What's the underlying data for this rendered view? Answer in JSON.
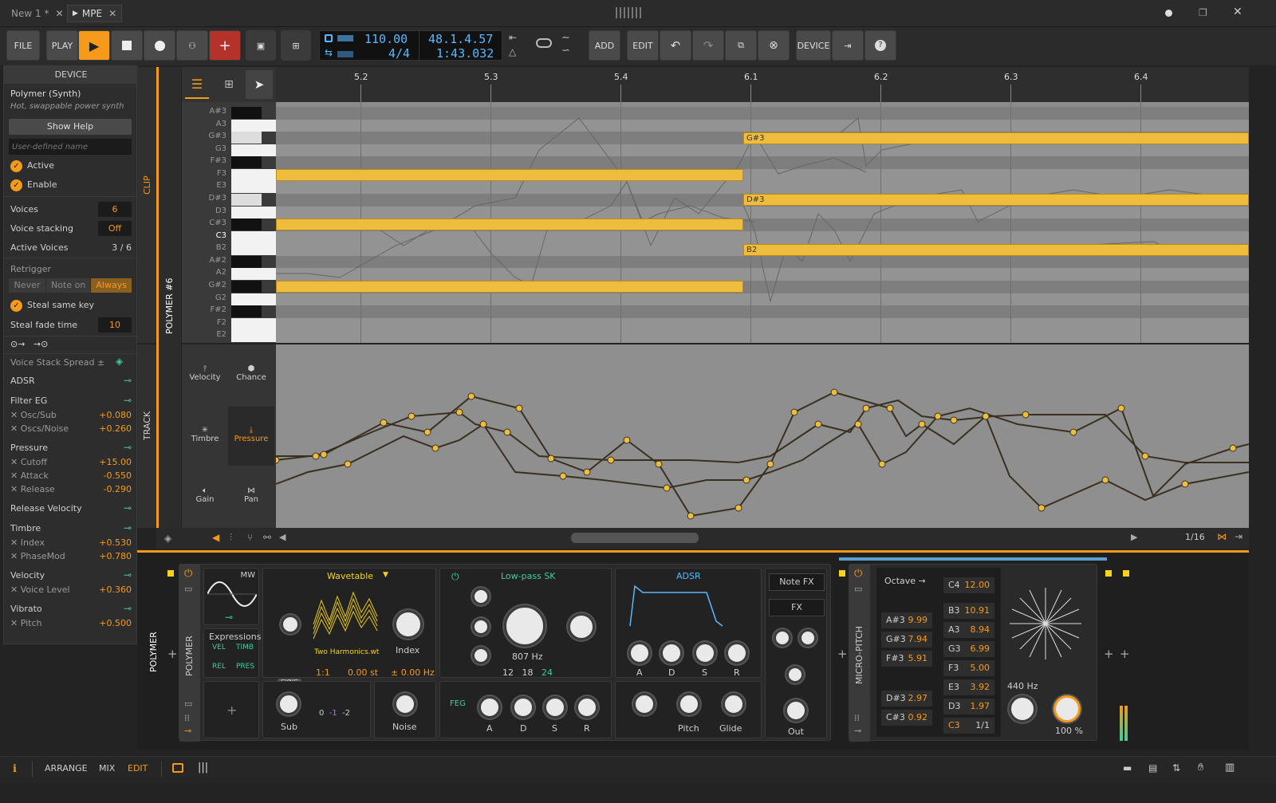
{
  "tabs": [
    {
      "label": "New 1 *"
    },
    {
      "label": "MPE"
    }
  ],
  "toolbar": {
    "file": "FILE",
    "play": "PLAY",
    "add": "ADD",
    "edit": "EDIT",
    "device": "DEVICE",
    "tempo": "110.00",
    "signature": "4/4",
    "position": "48.1.4.57",
    "time": "1:43.032"
  },
  "device": {
    "header": "DEVICE",
    "name": "Polymer (Synth)",
    "desc": "Hot, swappable power synth",
    "help": "Show Help",
    "user_name_placeholder": "User-defined name",
    "active": "Active",
    "enable": "Enable",
    "voices_label": "Voices",
    "voices": "6",
    "stacking_label": "Voice stacking",
    "stacking": "Off",
    "active_voices_label": "Active Voices",
    "active_voices": "3 / 6",
    "retrigger": "Retrigger",
    "never": "Never",
    "note_on": "Note on",
    "always": "Always",
    "steal": "Steal same key",
    "steal_fade_label": "Steal fade time",
    "steal_fade": "10",
    "spread": "Voice Stack Spread ±",
    "mods": [
      {
        "title": "ADSR",
        "items": []
      },
      {
        "title": "Filter EG",
        "items": [
          {
            "n": "Osc/Sub",
            "v": "+0.080"
          },
          {
            "n": "Oscs/Noise",
            "v": "+0.260"
          }
        ]
      },
      {
        "title": "Pressure",
        "items": [
          {
            "n": "Cutoff",
            "v": "+15.00"
          },
          {
            "n": "Attack",
            "v": "-0.550"
          },
          {
            "n": "Release",
            "v": "-0.290"
          }
        ]
      },
      {
        "title": "Release Velocity",
        "items": []
      },
      {
        "title": "Timbre",
        "items": [
          {
            "n": "Index",
            "v": "+0.530"
          },
          {
            "n": "PhaseMod",
            "v": "+0.780"
          }
        ]
      },
      {
        "title": "Velocity",
        "items": [
          {
            "n": "Voice Level",
            "v": "+0.360"
          }
        ]
      },
      {
        "title": "Vibrato",
        "items": [
          {
            "n": "Pitch",
            "v": "+0.500"
          }
        ]
      }
    ]
  },
  "strips": {
    "clip": "CLIP",
    "polymer6": "POLYMER #6",
    "track": "TRACK",
    "polymer": "POLYMER",
    "polymer2": "POLYMER",
    "micropitch": "MICRO-PITCH"
  },
  "ruler": [
    "5.2",
    "5.3",
    "5.4",
    "6.1",
    "6.2",
    "6.3",
    "6.4"
  ],
  "keys": [
    "A#3",
    "A3",
    "G#3",
    "G3",
    "F#3",
    "F3",
    "E3",
    "D#3",
    "D3",
    "C#3",
    "C3",
    "B2",
    "A#2",
    "A2",
    "G#2",
    "G2",
    "F#2",
    "F2",
    "E2"
  ],
  "notes": [
    {
      "label": "G#3"
    },
    {
      "label": "D#3"
    },
    {
      "label": "B2"
    }
  ],
  "lanes": {
    "velocity": "Velocity",
    "chance": "Chance",
    "timbre": "Timbre",
    "pressure": "Pressure",
    "gain": "Gain",
    "pan": "Pan",
    "grid": "1/16"
  },
  "polymer": {
    "mw": "MW",
    "wavetable": "Wavetable",
    "wt_file": "Two Harmonics.wt",
    "index": "Index",
    "ratio": "1:1",
    "st": "0.00 st",
    "hz": "± 0.00 Hz",
    "sync": "SYNC",
    "expressions": "Expressions",
    "vel": "VEL",
    "timb": "TIMB",
    "rel": "REL",
    "pres": "PRES",
    "sub": "Sub",
    "noise": "Noise",
    "sub_vals": [
      "0",
      "-1",
      "-2"
    ],
    "filter": "Low-pass SK",
    "cutoff": "807 Hz",
    "slopes": [
      "12",
      "18",
      "24"
    ],
    "feg": "FEG",
    "adsr": "ADSR",
    "a": "A",
    "d": "D",
    "s": "S",
    "r": "R",
    "pitch": "Pitch",
    "glide": "Glide",
    "out": "Out",
    "notefx": "Note FX",
    "fx": "FX"
  },
  "micro": {
    "octave": "Octave →",
    "rows": [
      {
        "k": "C4",
        "v": "12.00"
      },
      {
        "k": "B3",
        "v": "10.91"
      },
      {
        "k": "A#3",
        "v": "9.99"
      },
      {
        "k": "A3",
        "v": "8.94"
      },
      {
        "k": "G#3",
        "v": "7.94"
      },
      {
        "k": "G3",
        "v": "6.99"
      },
      {
        "k": "F#3",
        "v": "5.91"
      },
      {
        "k": "F3",
        "v": "5.00"
      },
      {
        "k": "E3",
        "v": "3.92"
      },
      {
        "k": "D#3",
        "v": "2.97"
      },
      {
        "k": "D3",
        "v": "1.97"
      },
      {
        "k": "C#3",
        "v": "0.92"
      },
      {
        "k": "C3",
        "v": "1/1"
      }
    ],
    "ref": "440 Hz",
    "pct": "100 %"
  },
  "status": {
    "arrange": "ARRANGE",
    "mix": "MIX",
    "edit": "EDIT"
  },
  "colors": {
    "accent": "#f59a1b",
    "note": "#eebd3e",
    "mod": "#3ccf9a",
    "lcd": "#5ab8ff"
  }
}
